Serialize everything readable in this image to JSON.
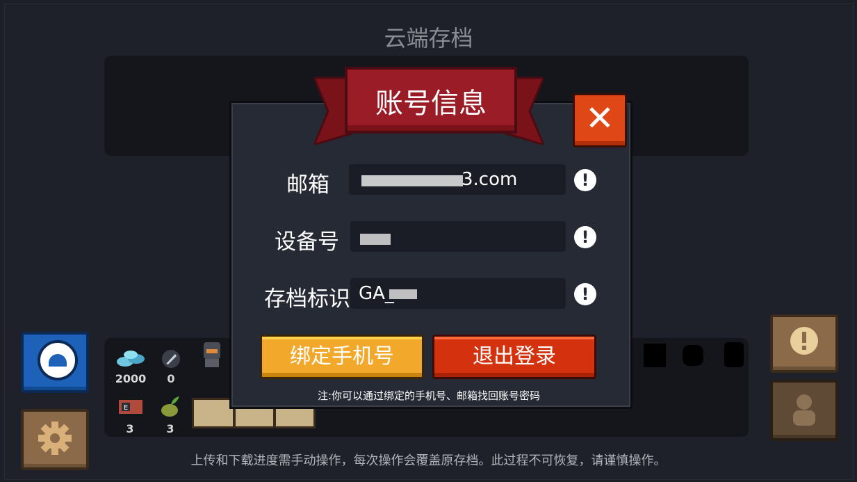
{
  "page": {
    "title": "云端存档",
    "footer_note": "上传和下载进度需手动操作，每次操作会覆盖原存档。此过程不可恢复，请谨慎操作。"
  },
  "resources": {
    "gems": "2000",
    "feathers": "0",
    "tickets": "3",
    "seeds": "3"
  },
  "dialog": {
    "title": "账号信息",
    "close_icon": "close-icon",
    "fields": [
      {
        "label": "邮箱",
        "value": "3.com"
      },
      {
        "label": "设备号",
        "value": ""
      },
      {
        "label": "存档标识",
        "value": "GA_"
      }
    ],
    "bind_phone_label": "绑定手机号",
    "logout_label": "退出登录",
    "note": "注:你可以通过绑定的手机号、邮箱找回账号密码"
  },
  "colors": {
    "bind_button": "#f2a82a",
    "logout_button": "#d4320e",
    "ribbon": "#9a1c26",
    "close_button": "#e04717"
  }
}
